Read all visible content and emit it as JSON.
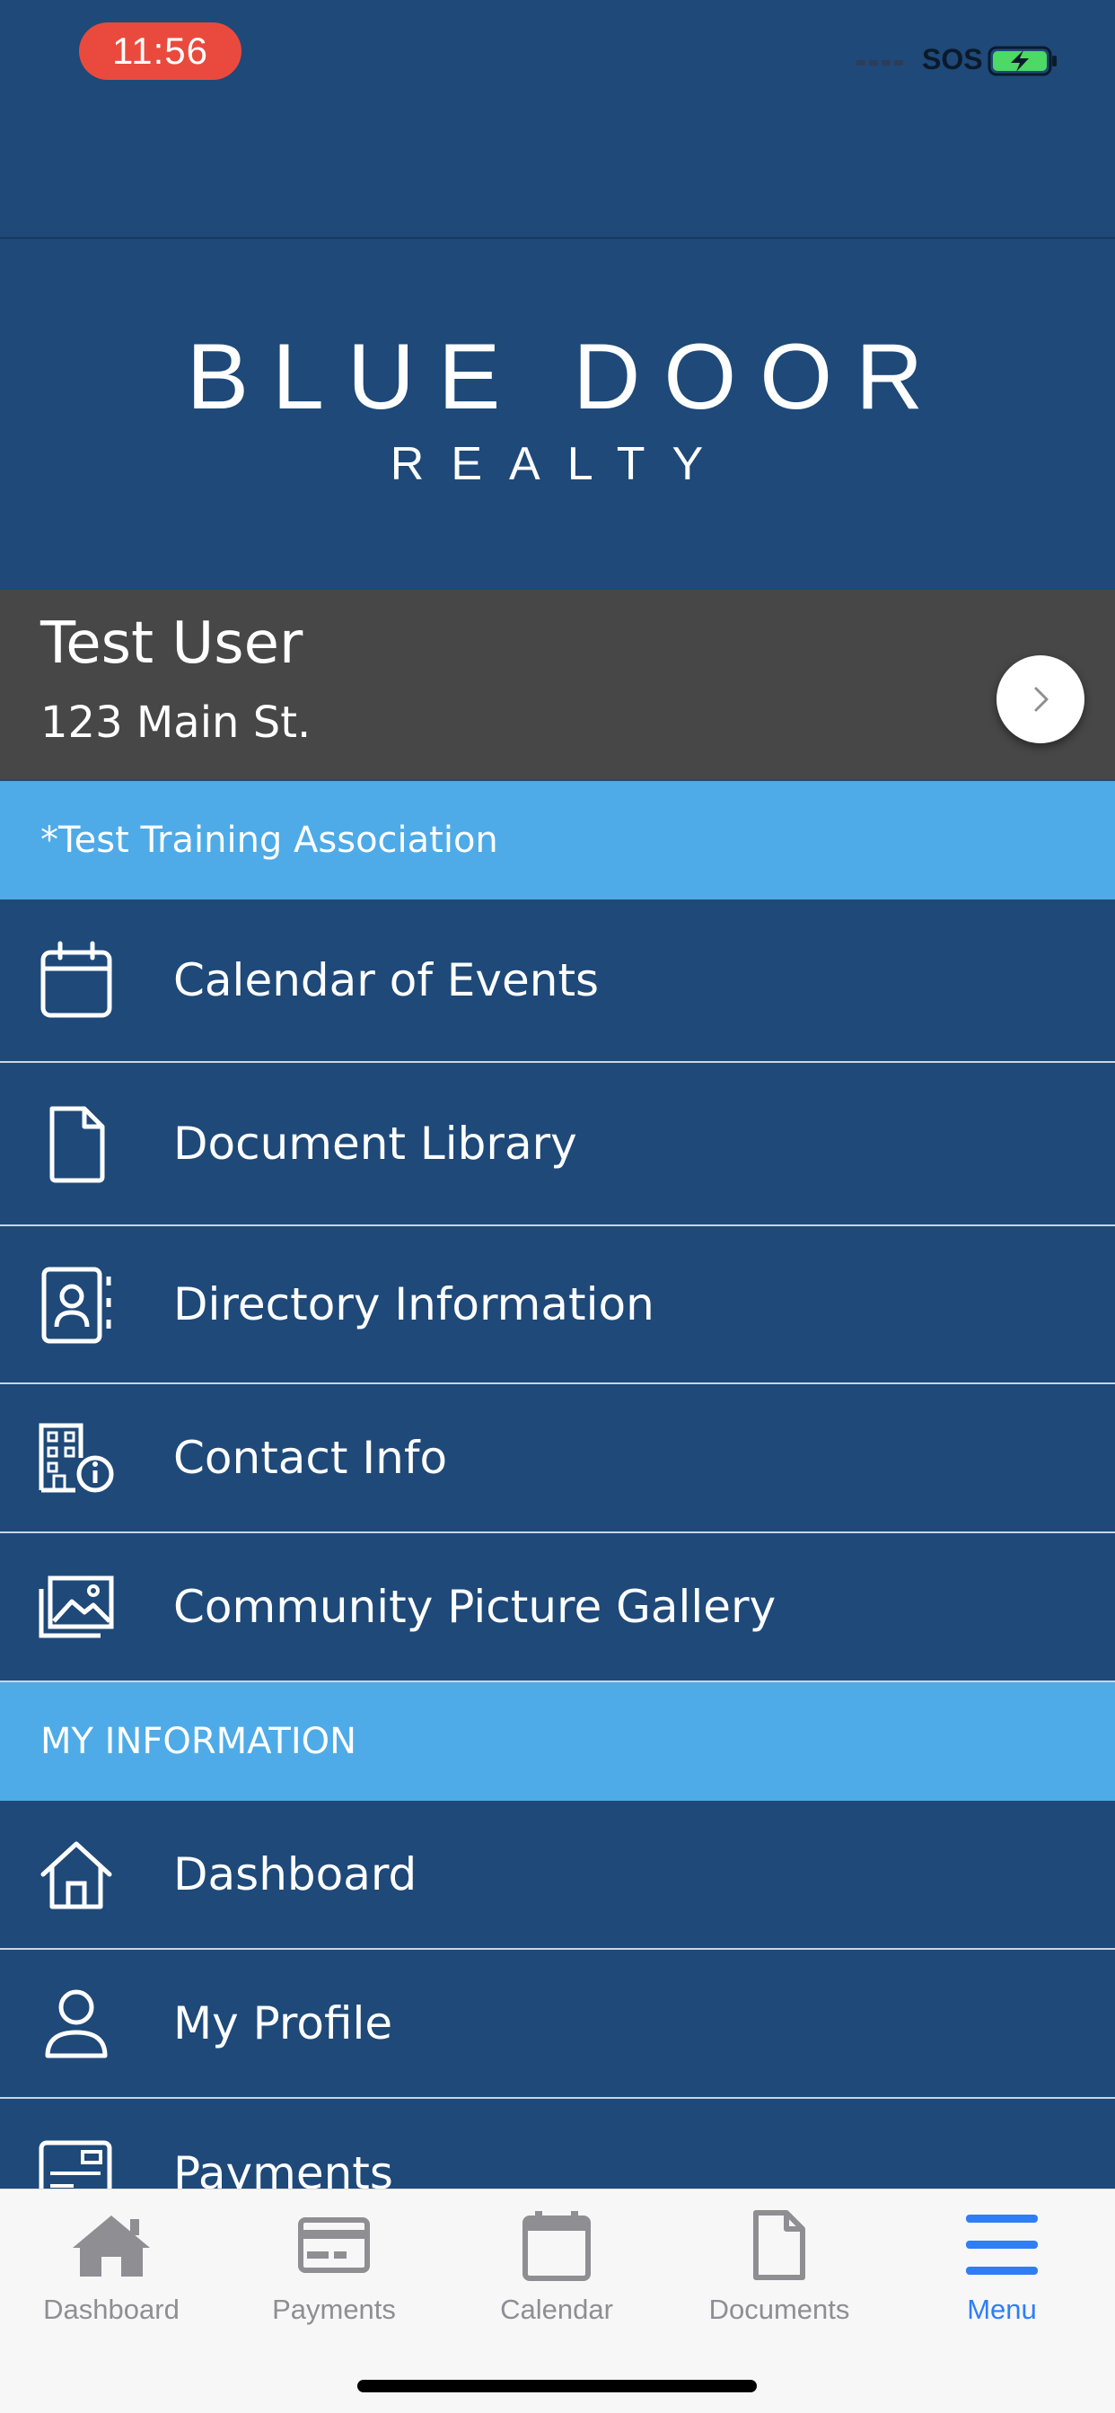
{
  "status_bar": {
    "time": "11:56",
    "carrier": "SOS"
  },
  "logo": {
    "main": "BLUE DOOR",
    "sub": "REALTY"
  },
  "user": {
    "name": "Test User",
    "address": "123 Main St."
  },
  "sections": [
    {
      "title": "*Test Training Association"
    },
    {
      "title": "MY INFORMATION"
    }
  ],
  "menu": {
    "association_items": [
      {
        "label": "Calendar of Events",
        "icon": "calendar-icon"
      },
      {
        "label": "Document Library",
        "icon": "document-icon"
      },
      {
        "label": "Directory Information",
        "icon": "contact-book-icon"
      },
      {
        "label": "Contact Info",
        "icon": "building-info-icon"
      },
      {
        "label": "Community Picture Gallery",
        "icon": "gallery-icon"
      }
    ],
    "my_info_items": [
      {
        "label": "Dashboard",
        "icon": "home-icon"
      },
      {
        "label": "My Profile",
        "icon": "person-icon"
      },
      {
        "label": "Payments",
        "icon": "payment-form-icon"
      }
    ]
  },
  "tab_bar": {
    "tabs": [
      {
        "label": "Dashboard",
        "icon": "home-icon",
        "active": false
      },
      {
        "label": "Payments",
        "icon": "credit-card-icon",
        "active": false
      },
      {
        "label": "Calendar",
        "icon": "calendar-icon",
        "active": false
      },
      {
        "label": "Documents",
        "icon": "document-icon",
        "active": false
      },
      {
        "label": "Menu",
        "icon": "menu-icon",
        "active": true
      }
    ]
  },
  "colors": {
    "primary_blue": "#1e4979",
    "section_blue": "#4eabe8",
    "user_card_gray": "#474747",
    "active_tab": "#2f7ef6",
    "inactive_tab": "#8e8e93",
    "time_pill": "#ea4a3d"
  }
}
